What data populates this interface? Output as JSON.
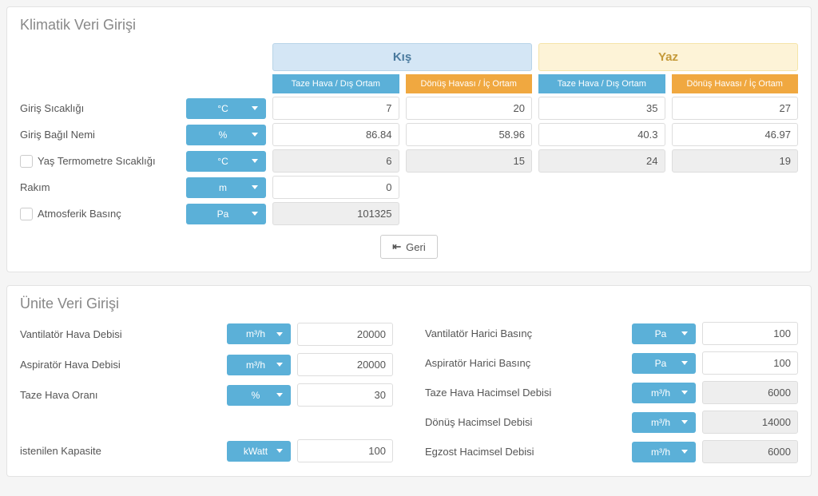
{
  "climate": {
    "title": "Klimatik Veri Girişi",
    "seasons": {
      "winter": "Kış",
      "summer": "Yaz"
    },
    "subheaders": {
      "fresh": "Taze Hava / Dış Ortam",
      "return": "Dönüş Havası / İç Ortam"
    },
    "rows": {
      "inlet_temp": {
        "label": "Giriş Sıcaklığı",
        "unit": "°C",
        "v": [
          "7",
          "20",
          "35",
          "27"
        ]
      },
      "rel_humidity": {
        "label": "Giriş Bağıl Nemi",
        "unit": "%",
        "v": [
          "86.84",
          "58.96",
          "40.3",
          "46.97"
        ]
      },
      "wet_bulb": {
        "label": "Yaş Termometre Sıcaklığı",
        "unit": "°C",
        "v": [
          "6",
          "15",
          "24",
          "19"
        ]
      },
      "altitude": {
        "label": "Rakım",
        "unit": "m",
        "v": [
          "0"
        ]
      },
      "pressure": {
        "label": "Atmosferik Basınç",
        "unit": "Pa",
        "v": [
          "101325"
        ]
      }
    },
    "back": "Geri"
  },
  "unit": {
    "title": "Ünite Veri Girişi",
    "left": {
      "fan_flow": {
        "label": "Vantilatör Hava Debisi",
        "unit": "m³/h",
        "value": "20000"
      },
      "asp_flow": {
        "label": "Aspiratör Hava Debisi",
        "unit": "m³/h",
        "value": "20000"
      },
      "fresh_ratio": {
        "label": "Taze Hava Oranı",
        "unit": "%",
        "value": "30"
      },
      "capacity": {
        "label": "istenilen Kapasite",
        "unit": "kWatt",
        "value": "100"
      }
    },
    "right": {
      "fan_ext_p": {
        "label": "Vantilatör Harici Basınç",
        "unit": "Pa",
        "value": "100"
      },
      "asp_ext_p": {
        "label": "Aspiratör Harici Basınç",
        "unit": "Pa",
        "value": "100"
      },
      "fresh_vol": {
        "label": "Taze Hava Hacimsel Debisi",
        "unit": "m³/h",
        "value": "6000"
      },
      "return_vol": {
        "label": "Dönüş Hacimsel Debisi",
        "unit": "m³/h",
        "value": "14000"
      },
      "exhaust_vol": {
        "label": "Egzost Hacimsel Debisi",
        "unit": "m³/h",
        "value": "6000"
      }
    }
  }
}
